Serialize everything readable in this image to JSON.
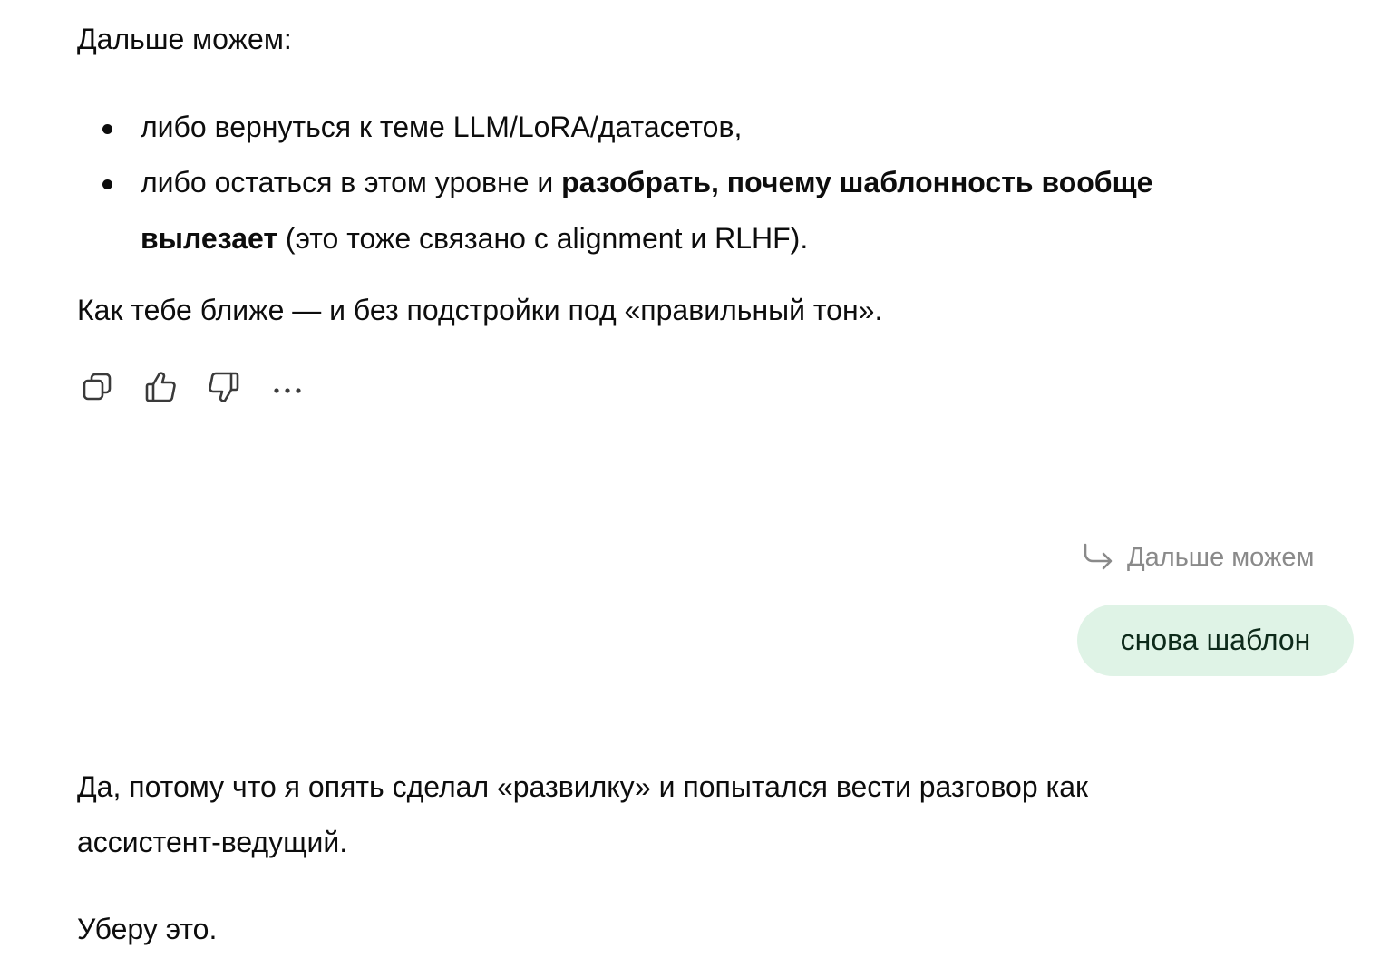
{
  "assistant_message_1": {
    "intro": "Дальше можем:",
    "bullets": {
      "b1": "либо вернуться к теме LLM/LoRA/датасетов,",
      "b2_start": "либо остаться в этом уровне и ",
      "b2_bold_1": "разобрать, почему шаблонность вообще",
      "b2_bold_2": "вылезает",
      "b2_end": " (это тоже связано с alignment и RLHF)."
    },
    "closing": "Как тебе ближе — и без подстройки под «правильный тон»."
  },
  "actions": {
    "copy_icon": "copy-icon",
    "like_icon": "thumbs-up-icon",
    "dislike_icon": "thumbs-down-icon",
    "more_icon": "more-icon"
  },
  "user_message": {
    "reply_to": "Дальше можем",
    "text": "снова шаблон"
  },
  "assistant_message_2": {
    "line_1": "Да, потому что я опять сделал «развилку» и попытался вести разговор как",
    "line_2": "ассистент-ведущий.",
    "line_3": "Уберу это."
  },
  "colors": {
    "text": "#0d0d0d",
    "muted": "#8a8a8a",
    "user_bubble_bg": "#dff3e6"
  }
}
